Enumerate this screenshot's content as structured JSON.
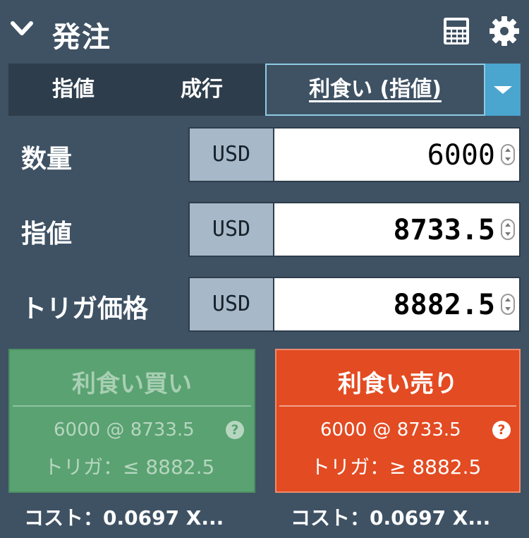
{
  "header": {
    "title": "発注"
  },
  "tabs": [
    {
      "label": "指値"
    },
    {
      "label": "成行"
    },
    {
      "label": "利食い (指値)"
    }
  ],
  "rows": [
    {
      "label": "数量",
      "unit": "USD",
      "value": "6000"
    },
    {
      "label": "指値",
      "unit": "USD",
      "value": "8733.5"
    },
    {
      "label": "トリガ価格",
      "unit": "USD",
      "value": "8882.5"
    }
  ],
  "buy": {
    "title": "利食い買い",
    "line1": "6000 @ 8733.5",
    "line2": "トリガ：≤ 8882.5",
    "help": "?",
    "cost": "コスト：0.0697 X..."
  },
  "sell": {
    "title": "利食い売り",
    "line1": "6000 @ 8733.5",
    "line2": "トリガ：≥ 8882.5",
    "help": "?",
    "cost": "コスト：0.0697 X..."
  },
  "colors": {
    "background": "#3f5264",
    "tab_bar": "#2e3d4b",
    "dropdown": "#4aa5cf",
    "buy": "#5aa271",
    "sell": "#e34b22"
  },
  "icons": [
    "chevron-down-icon",
    "calculator-icon",
    "gear-icon",
    "question-icon",
    "caret-down-icon"
  ]
}
